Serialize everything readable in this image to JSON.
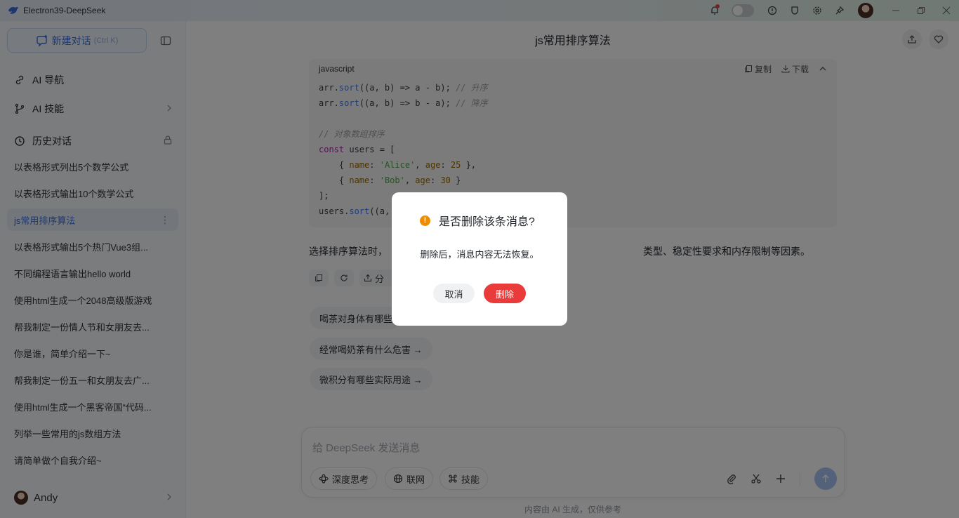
{
  "app": {
    "title": "Electron39-DeepSeek"
  },
  "sidebar": {
    "new_chat_label": "新建对话",
    "new_chat_shortcut": "(Ctrl K)",
    "nav": [
      {
        "label": "AI 导航",
        "icon": "link-icon"
      },
      {
        "label": "AI 技能",
        "icon": "branch-icon"
      }
    ],
    "history_title": "历史对话",
    "history": [
      "以表格形式列出5个数学公式",
      "以表格形式输出10个数学公式",
      "js常用排序算法",
      "以表格形式输出5个热门Vue3组...",
      "不同编程语言输出hello world",
      "使用html生成一个2048高级版游戏",
      "帮我制定一份情人节和女朋友去...",
      "你是谁，简单介绍一下~",
      "帮我制定一份五一和女朋友去广...",
      "使用html生成一个黑客帝国“代码...",
      "列举一些常用的js数组方法",
      "请简单做个自我介绍~"
    ],
    "active_index": 2,
    "more_glyph": "⋮",
    "user_name": "Andy"
  },
  "chat": {
    "title": "js常用排序算法",
    "code": {
      "language": "javascript",
      "copy_label": "复制",
      "download_label": "下载",
      "lines": [
        "arr.sort((a, b) => a - b); // 升序",
        "arr.sort((a, b) => b - a); // 降序",
        "",
        "// 对象数组排序",
        "const users = [",
        "    { name: 'Alice', age: 25 },",
        "    { name: 'Bob', age: 30 }",
        "];",
        "users.sort((a,"
      ]
    },
    "summary_left": "选择排序算法时，",
    "summary_right": "类型、稳定性要求和内存限制等因素。",
    "share_label": "分",
    "suggestions": [
      "喝茶对身体有哪些",
      "经常喝奶茶有什么危害 →",
      "微积分有哪些实际用途 →"
    ]
  },
  "composer": {
    "placeholder": "给 DeepSeek 发送消息",
    "chips": [
      "深度思考",
      "联网",
      "技能"
    ],
    "disclaimer": "内容由 AI 生成，仅供参考"
  },
  "dialog": {
    "title": "是否删除该条消息?",
    "message": "删除后，消息内容无法恢复。",
    "cancel_label": "取消",
    "delete_label": "删除",
    "warn_glyph": "!"
  },
  "colors": {
    "accent": "#3b6fd8",
    "danger": "#ea3b3b",
    "warning": "#f08c00"
  }
}
